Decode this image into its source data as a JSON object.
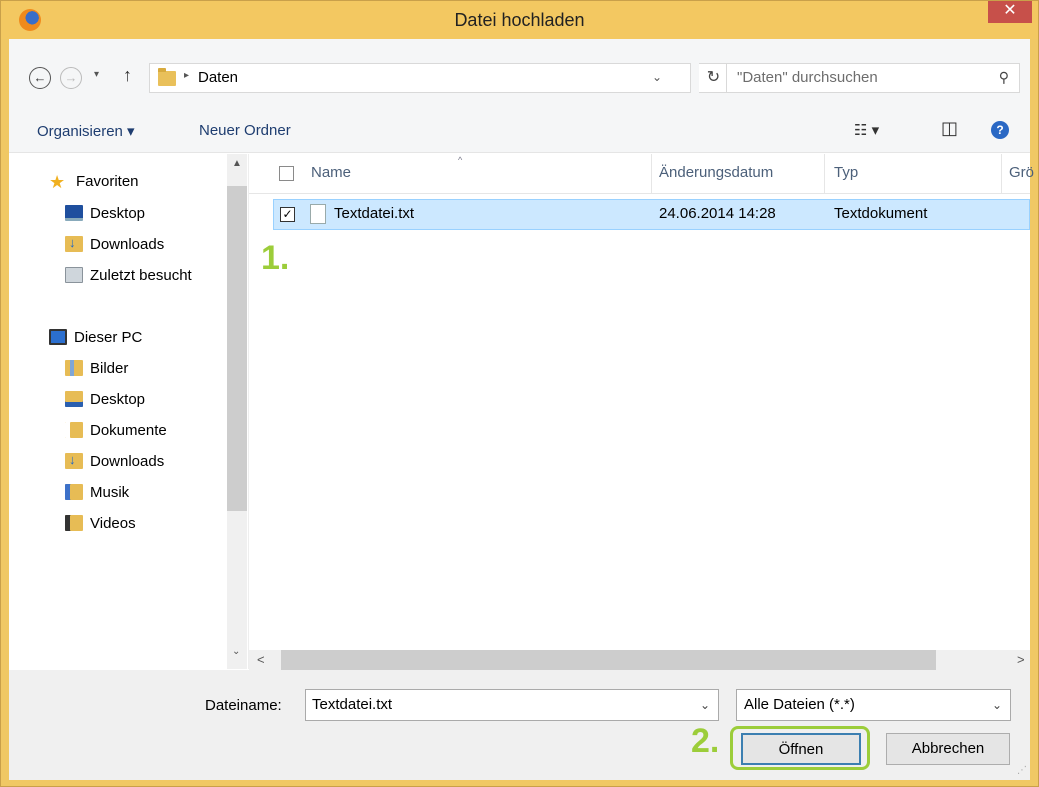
{
  "window": {
    "title": "Datei hochladen",
    "close_glyph": "✕"
  },
  "nav": {
    "back_glyph": "←",
    "forward_glyph": "→",
    "recent_glyph": "▾",
    "up_glyph": "↑",
    "address": {
      "breadcrumb_arrow": "▸",
      "path": "Daten",
      "dropdown_glyph": "⌄"
    },
    "refresh_glyph": "↻",
    "search_placeholder": "\"Daten\" durchsuchen",
    "search_glyph": "⚲"
  },
  "toolbar": {
    "organize": "Organisieren ▾",
    "new_folder": "Neuer Ordner",
    "view_glyph": "☷ ▾",
    "preview_glyph": "◫",
    "help_glyph": "?"
  },
  "sidebar": {
    "favorites": "Favoriten",
    "favorites_items": [
      "Desktop",
      "Downloads",
      "Zuletzt besucht"
    ],
    "pc": "Dieser PC",
    "pc_items": [
      "Bilder",
      "Desktop",
      "Dokumente",
      "Downloads",
      "Musik",
      "Videos"
    ],
    "star_glyph": "★"
  },
  "filelist": {
    "columns": [
      "Name",
      "Änderungsdatum",
      "Typ",
      "Grö"
    ],
    "sort_glyph": "^",
    "rows": [
      {
        "checked": "✓",
        "name": "Textdatei.txt",
        "date": "24.06.2014 14:28",
        "type": "Textdokument"
      }
    ]
  },
  "annotations": {
    "step1": "1.",
    "step2": "2."
  },
  "scroll": {
    "up": "▲",
    "down": "⌄",
    "left": "<",
    "right": ">"
  },
  "footer": {
    "filename_label": "Dateiname:",
    "filename_value": "Textdatei.txt",
    "dropdown_glyph": "⌄",
    "filetype": "Alle Dateien (*.*)",
    "open_button": "Öffnen",
    "cancel_button": "Abbrechen",
    "grip": "⋰"
  },
  "colors": {
    "titlebar": "#f3c861",
    "close": "#c7504a",
    "selection": "#cce8ff",
    "annotation": "#9ccd3a"
  }
}
